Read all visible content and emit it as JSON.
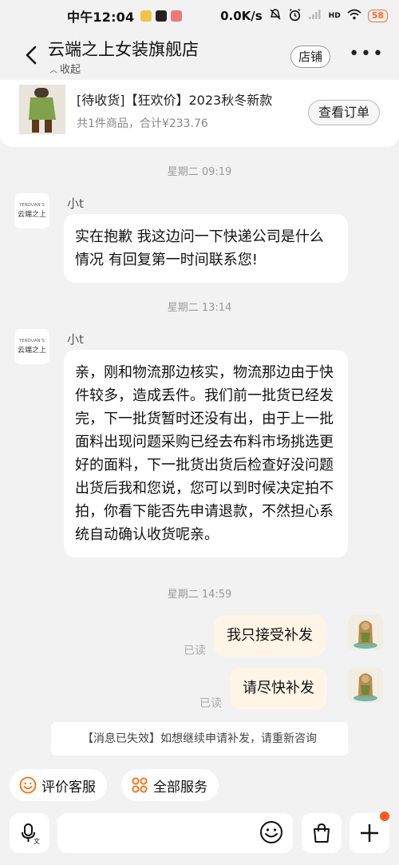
{
  "status_bar": {
    "time": "中午12:04",
    "net_speed": "0.0K/s",
    "signal": "HD",
    "battery": "58"
  },
  "header": {
    "title": "云端之上女装旗舰店",
    "collapse_label": "收起",
    "store_button": "店铺",
    "more": "•••"
  },
  "order": {
    "title": "[待收货]【狂欢价】2023秋冬新款",
    "summary": "共1件商品，合计¥233.76",
    "view_button": "查看订单"
  },
  "chat": {
    "shop_avatar_line1": "YENDUAN'S",
    "shop_avatar_line2": "云端之上",
    "messages": [
      {
        "time": "星期二 09:19",
        "sender": "小t",
        "text": "实在抱歉 我这边问一下快递公司是什么情况 有回复第一时间联系您!"
      },
      {
        "time": "星期二 13:14",
        "sender": "小t",
        "text": "亲，刚和物流那边核实，物流那边由于快件较多，造成丢件。我们前一批货已经发完，下一批货暂时还没有出，由于上一批面料出现问题采购已经去布料市场挑选更好的面料，下一批货出货后检查好没问题出货后我和您说，您可以到时候决定拍不拍，你看下能否先申请退款，不然担心系统自动确认收货呢亲。"
      }
    ],
    "outgoing_time": "星期二 14:59",
    "outgoing": [
      {
        "text": "我只接受补发",
        "status": "已读"
      },
      {
        "text": "请尽快补发",
        "status": "已读"
      }
    ],
    "notice": "【消息已失效】如想继续申请补发，请重新咨询"
  },
  "quick_actions": [
    {
      "label": "评价客服",
      "icon": "smile-face-icon"
    },
    {
      "label": "全部服务",
      "icon": "grid-services-icon"
    }
  ],
  "input_bar": {
    "voice_icon": "voice-translate-icon",
    "emoji_icon": "emoji-icon",
    "bag_icon": "shopping-bag-icon",
    "plus_icon": "plus-icon"
  },
  "colors": {
    "accent": "#ff6a00",
    "outgoing_bubble": "#fff5e6",
    "background": "#f2f2f2",
    "badge_dot": "#ff5a1f"
  }
}
